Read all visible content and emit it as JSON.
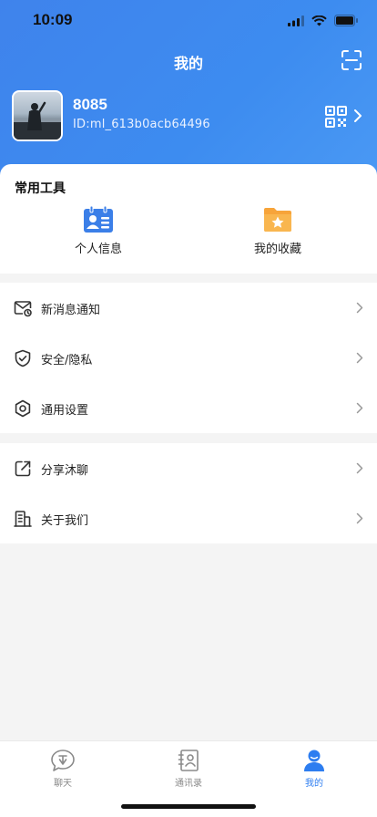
{
  "status_bar": {
    "time": "10:09"
  },
  "header": {
    "title": "我的"
  },
  "profile": {
    "name": "8085",
    "user_id": "ID:ml_613b0acb64496"
  },
  "tools": {
    "title": "常用工具",
    "items": [
      {
        "label": "个人信息",
        "icon": "id-card-icon"
      },
      {
        "label": "我的收藏",
        "icon": "star-folder-icon"
      }
    ]
  },
  "menu": {
    "group1": [
      {
        "label": "新消息通知",
        "icon": "mail-bell-icon"
      },
      {
        "label": "安全/隐私",
        "icon": "shield-check-icon"
      },
      {
        "label": "通用设置",
        "icon": "gear-icon"
      }
    ],
    "group2": [
      {
        "label": "分享沐聊",
        "icon": "share-icon"
      },
      {
        "label": "关于我们",
        "icon": "building-icon"
      }
    ]
  },
  "tabbar": {
    "items": [
      {
        "label": "聊天",
        "active": false
      },
      {
        "label": "通讯录",
        "active": false
      },
      {
        "label": "我的",
        "active": true
      }
    ]
  },
  "colors": {
    "accent": "#2d7df0",
    "header_blue": "#3f83ec",
    "background": "#f4f4f4"
  }
}
